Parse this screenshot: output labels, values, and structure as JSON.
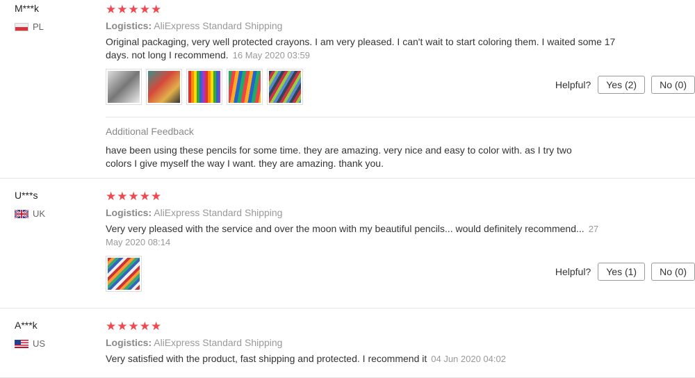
{
  "reviews": [
    {
      "user": "M***k",
      "country": "PL",
      "stars": "★★★★★",
      "logistics_label": "Logistics:",
      "logistics_value": "AliExpress Standard Shipping",
      "text": "Original packaging, very well protected crayons. I am very pleased. I can't wait to start coloring them. I waited some 17 days. not long I recommend.",
      "date": "16 May 2020 03:59",
      "helpful_label": "Helpful?",
      "yes_label": "Yes (2)",
      "no_label": "No (0)",
      "additional_title": "Additional Feedback",
      "additional_text": "have been using these pencils for some time. they are amazing. very nice and easy to color with. as I try two colors I give myself the way I want. they are amazing. thank you."
    },
    {
      "user": "U***s",
      "country": "UK",
      "stars": "★★★★★",
      "logistics_label": "Logistics:",
      "logistics_value": "AliExpress Standard Shipping",
      "text": "Very very pleased with the service and over the moon with my beautiful pencils... would definitely recommend...",
      "date": "27 May 2020 08:14",
      "helpful_label": "Helpful?",
      "yes_label": "Yes (1)",
      "no_label": "No (0)"
    },
    {
      "user": "A***k",
      "country": "US",
      "stars": "★★★★★",
      "logistics_label": "Logistics:",
      "logistics_value": "AliExpress Standard Shipping",
      "text": "Very satisfied with the product, fast shipping and protected. I recommend it",
      "date": "04 Jun 2020 04:02"
    }
  ],
  "colors": {
    "star": "#f0484e",
    "muted": "#999999",
    "text": "#333333"
  }
}
